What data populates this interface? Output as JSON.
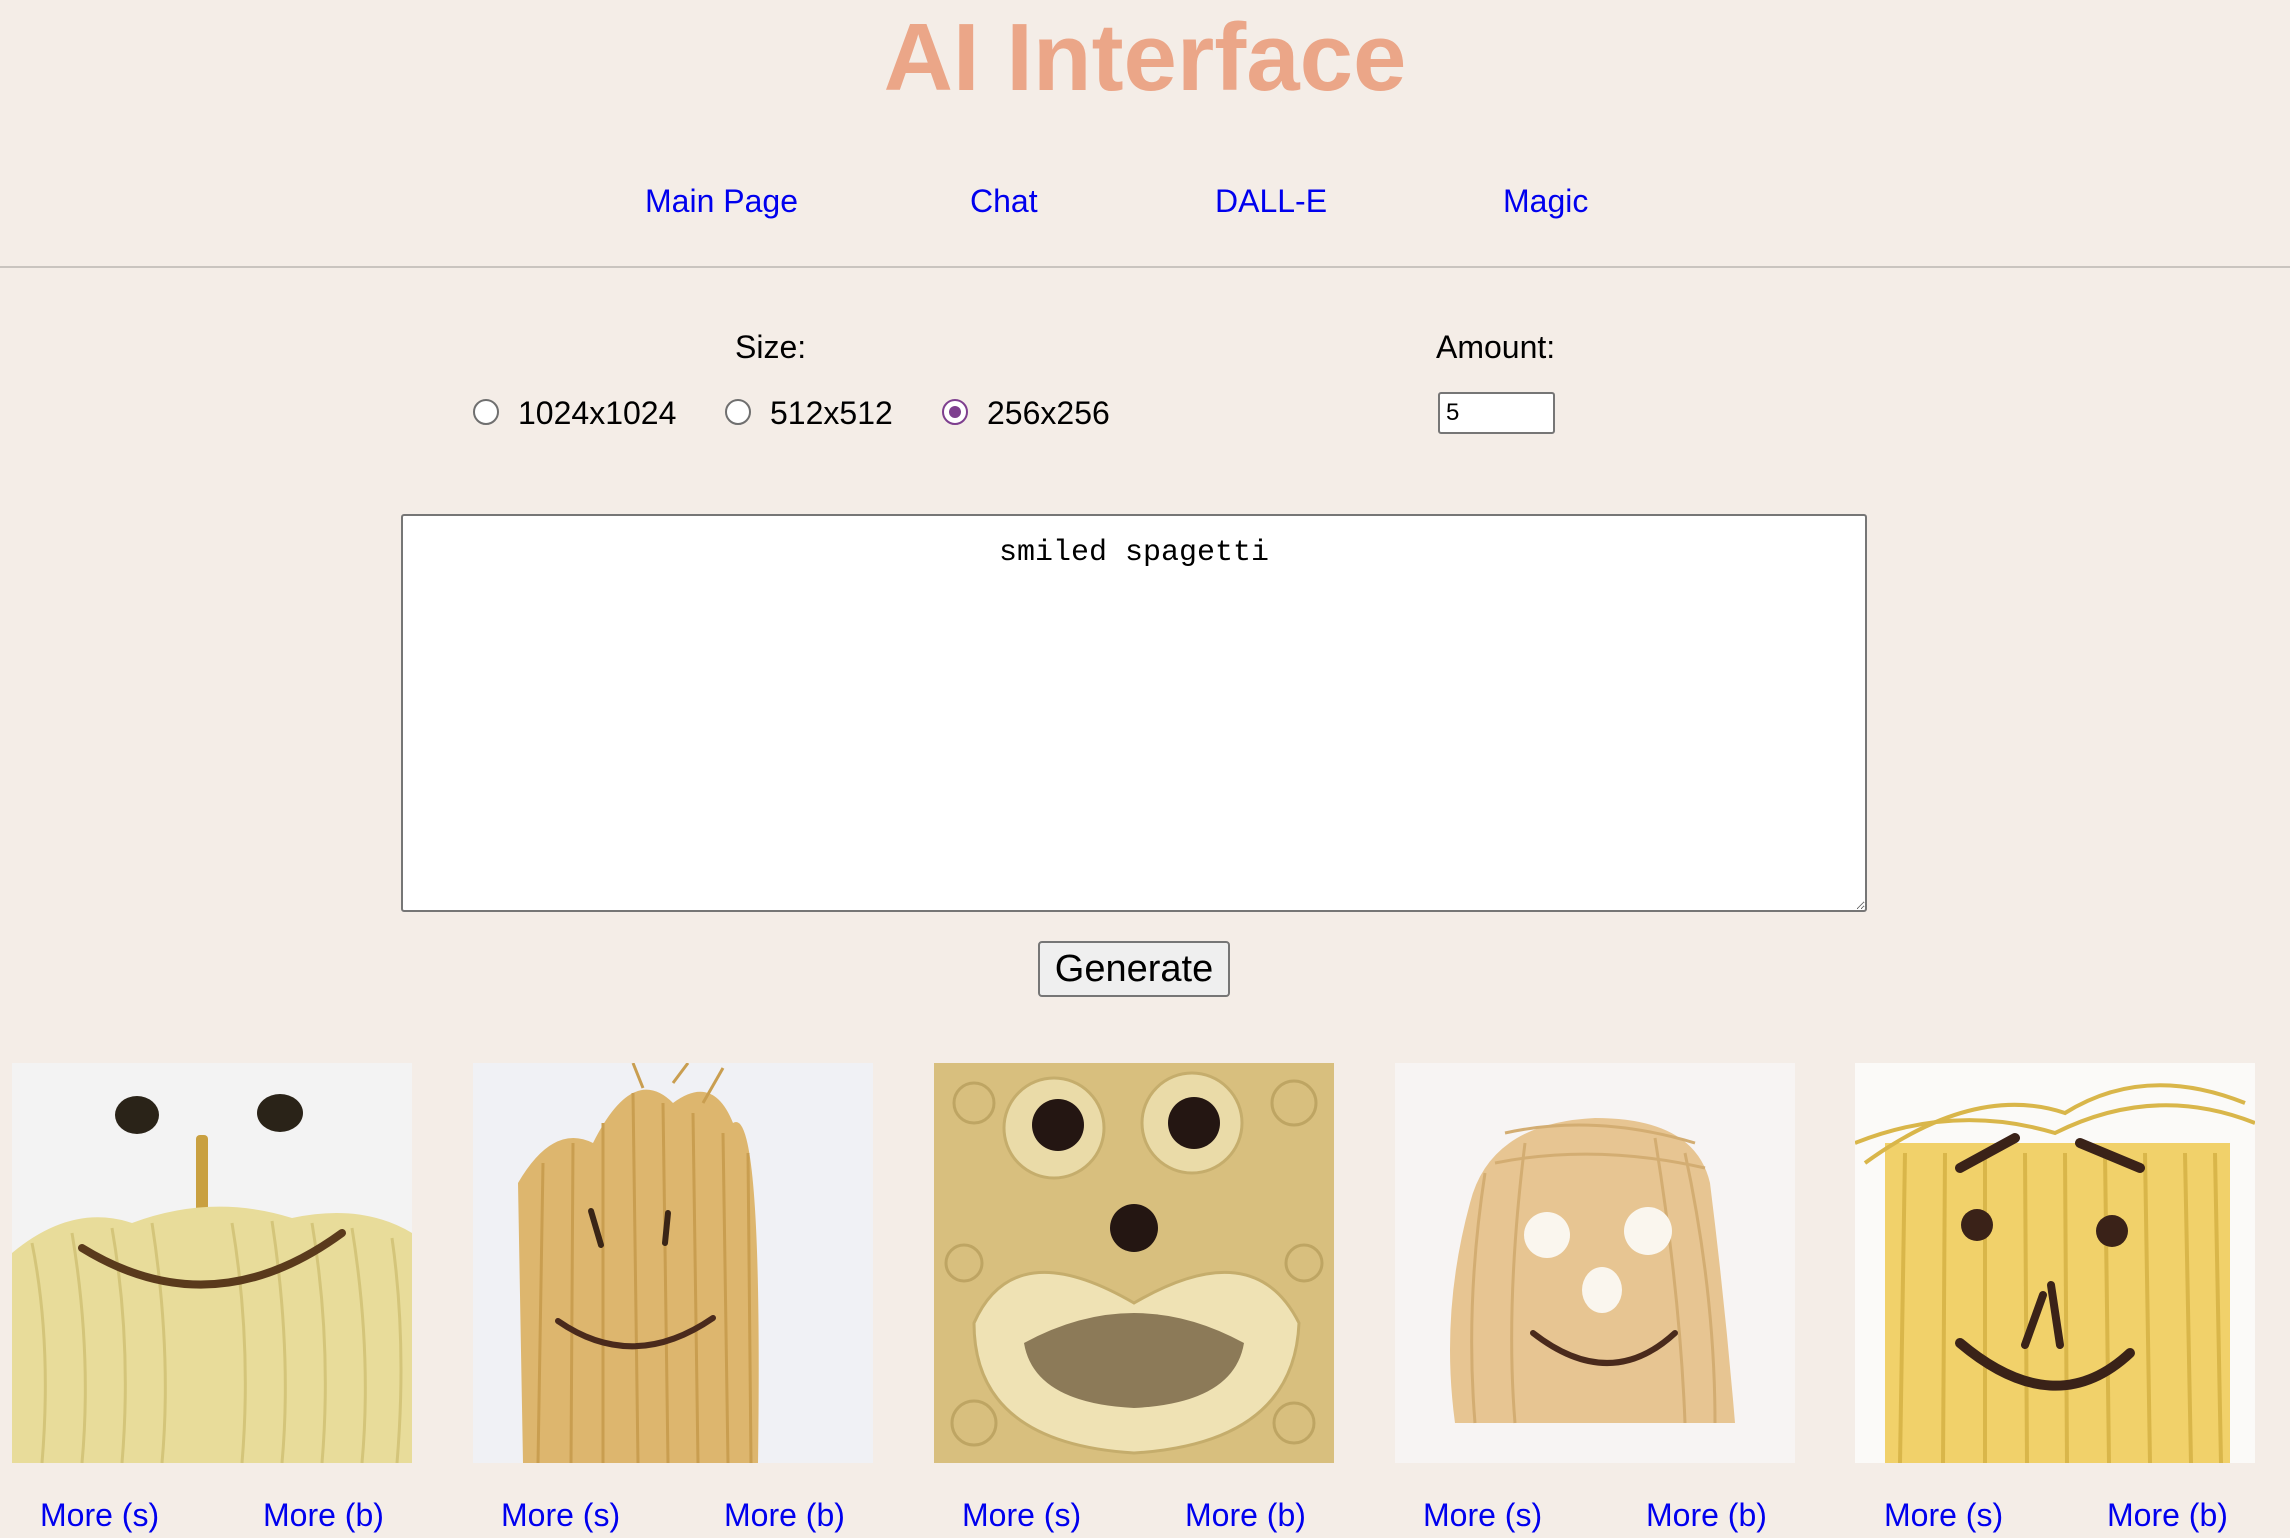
{
  "app": {
    "title": "AI Interface"
  },
  "nav": {
    "items": [
      {
        "label": "Main Page"
      },
      {
        "label": "Chat"
      },
      {
        "label": "DALL-E"
      },
      {
        "label": "Magic"
      }
    ]
  },
  "form": {
    "size_label": "Size:",
    "size_options": [
      {
        "label": "1024x1024",
        "checked": false
      },
      {
        "label": "512x512",
        "checked": false
      },
      {
        "label": "256x256",
        "checked": true
      }
    ],
    "amount_label": "Amount:",
    "amount_value": "5",
    "prompt": "smiled spagetti",
    "generate_label": "Generate"
  },
  "results": {
    "images": [
      {
        "more_small": "More (s)",
        "more_big": "More (b)"
      },
      {
        "more_small": "More (s)",
        "more_big": "More (b)"
      },
      {
        "more_small": "More (s)",
        "more_big": "More (b)"
      },
      {
        "more_small": "More (s)",
        "more_big": "More (b)"
      },
      {
        "more_small": "More (s)",
        "more_big": "More (b)"
      }
    ]
  },
  "colors": {
    "background": "#f4ede7",
    "title": "#eba688",
    "link": "#0000ee",
    "radio_checked": "#7e3f8f"
  }
}
